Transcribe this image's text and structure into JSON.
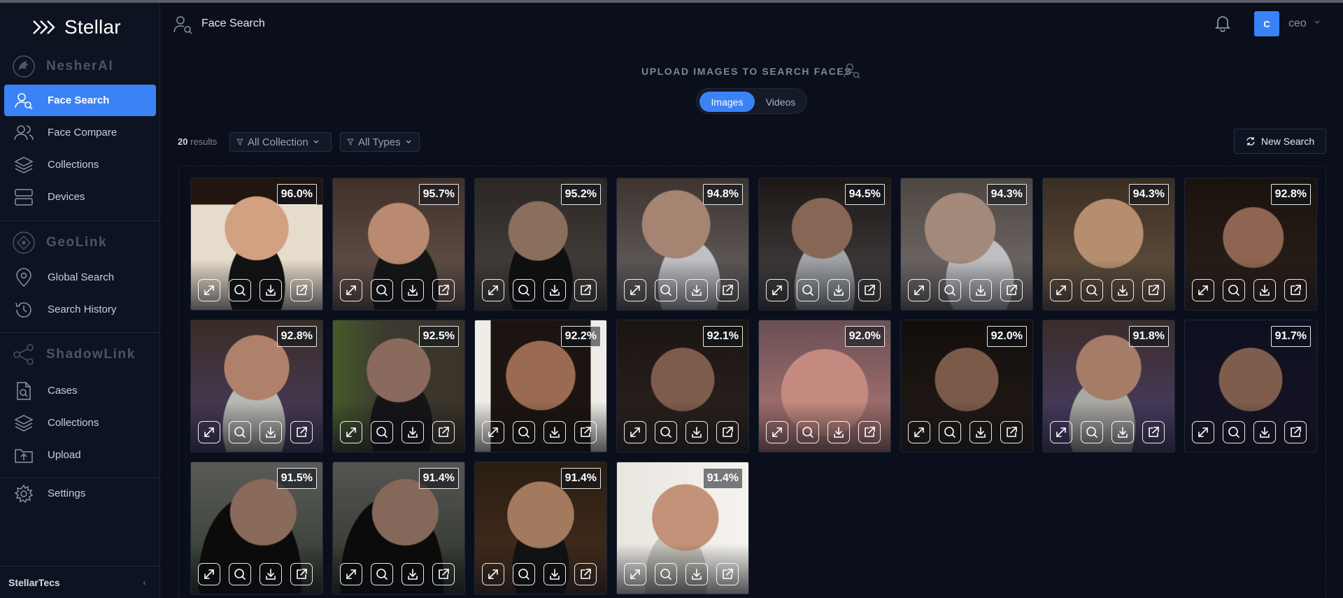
{
  "app": {
    "brand": "Stellar"
  },
  "sidebar": {
    "sections": [
      {
        "title": "NesherAI",
        "icon": "eagle-icon"
      },
      {
        "title": "GeoLink",
        "icon": "geolink-icon"
      },
      {
        "title": "ShadowLink",
        "icon": "share-nodes-icon"
      }
    ],
    "items": [
      {
        "label": "Face Search",
        "icon": "face-search-icon",
        "active": true
      },
      {
        "label": "Face Compare",
        "icon": "users-icon"
      },
      {
        "label": "Collections",
        "icon": "layers-icon"
      },
      {
        "label": "Devices",
        "icon": "server-icon"
      },
      {
        "label": "Global Search",
        "icon": "map-pin-icon"
      },
      {
        "label": "Search History",
        "icon": "history-icon"
      },
      {
        "label": "Cases",
        "icon": "file-search-icon"
      },
      {
        "label": "Collections",
        "icon": "layers-icon"
      },
      {
        "label": "Upload",
        "icon": "folder-upload-icon"
      },
      {
        "label": "Settings",
        "icon": "gear-icon"
      }
    ],
    "footer": {
      "label": "StellarTecs",
      "collapse": "‹"
    }
  },
  "header": {
    "page_title": "Face Search",
    "avatar_initial": "C",
    "user": "ceo"
  },
  "upload": {
    "title": "UPLOAD IMAGES TO SEARCH FACES"
  },
  "toggle": {
    "images": "Images",
    "videos": "Videos",
    "selected": "Images"
  },
  "results": {
    "count": "20",
    "count_suffix": "results",
    "filter_collection": "All Collection",
    "filter_types": "All Types",
    "new_search": "New Search"
  },
  "colors": {
    "accent": "#3b82f6",
    "background": "#0a0f1b",
    "sidebar": "#0d1320"
  },
  "cards": [
    {
      "score": "96.0%"
    },
    {
      "score": "95.7%"
    },
    {
      "score": "95.2%"
    },
    {
      "score": "94.8%"
    },
    {
      "score": "94.5%"
    },
    {
      "score": "94.3%"
    },
    {
      "score": "94.3%"
    },
    {
      "score": "92.8%"
    },
    {
      "score": "92.8%"
    },
    {
      "score": "92.5%"
    },
    {
      "score": "92.2%"
    },
    {
      "score": "92.1%"
    },
    {
      "score": "92.0%"
    },
    {
      "score": "92.0%"
    },
    {
      "score": "91.8%"
    },
    {
      "score": "91.7%"
    },
    {
      "score": "91.5%"
    },
    {
      "score": "91.4%"
    },
    {
      "score": "91.4%"
    },
    {
      "score": "91.4%"
    }
  ]
}
